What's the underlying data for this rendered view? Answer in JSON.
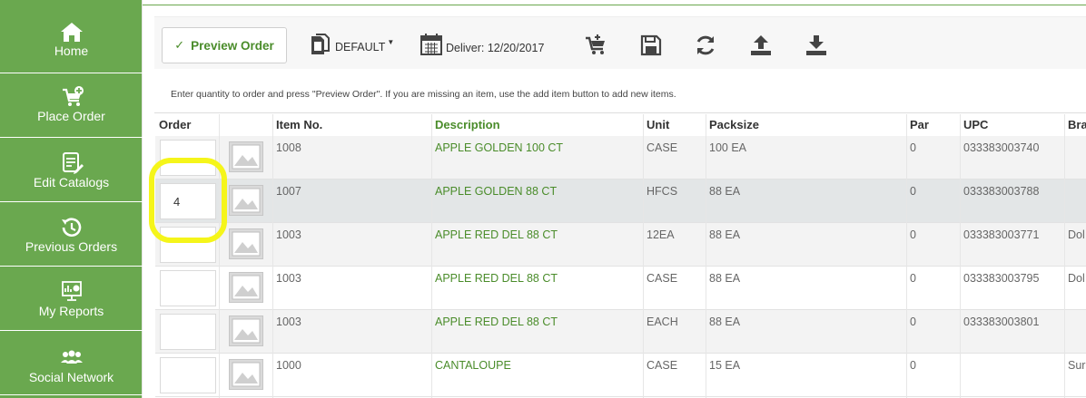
{
  "sidebar": {
    "items": [
      {
        "label": "Home",
        "icon": "home-icon"
      },
      {
        "label": "Place Order",
        "icon": "cart-plus-icon"
      },
      {
        "label": "Edit Catalogs",
        "icon": "edit-catalog-icon"
      },
      {
        "label": "Previous Orders",
        "icon": "history-icon"
      },
      {
        "label": "My Reports",
        "icon": "reports-icon"
      },
      {
        "label": "Social Network",
        "icon": "people-icon"
      }
    ]
  },
  "toolbar": {
    "preview_label": "Preview Order",
    "catalog_label": "DEFAULT",
    "deliver_label": "Deliver: 12/20/2017"
  },
  "hint": "Enter quantity to order and press \"Preview Order\". If you are missing an item, use the add item button to add new items.",
  "table": {
    "headers": {
      "order": "Order",
      "item_no": "Item No.",
      "description": "Description",
      "unit": "Unit",
      "packsize": "Packsize",
      "par": "Par",
      "upc": "UPC",
      "brand": "Bra"
    },
    "rows": [
      {
        "qty": "",
        "item_no": "1008",
        "description": "APPLE GOLDEN 100 CT",
        "unit": "CASE",
        "packsize": "100 EA",
        "par": "0",
        "upc": "033383003740",
        "brand": ""
      },
      {
        "qty": "4",
        "item_no": "1007",
        "description": "APPLE GOLDEN 88 CT",
        "unit": "HFCS",
        "packsize": "88 EA",
        "par": "0",
        "upc": "033383003788",
        "brand": ""
      },
      {
        "qty": "",
        "item_no": "1003",
        "description": "APPLE RED DEL 88 CT",
        "unit": "12EA",
        "packsize": "88 EA",
        "par": "0",
        "upc": "033383003771",
        "brand": "Dol"
      },
      {
        "qty": "",
        "item_no": "1003",
        "description": "APPLE RED DEL 88 CT",
        "unit": "CASE",
        "packsize": "88 EA",
        "par": "0",
        "upc": "033383003795",
        "brand": "Dol"
      },
      {
        "qty": "",
        "item_no": "1003",
        "description": "APPLE RED DEL 88 CT",
        "unit": "EACH",
        "packsize": "88 EA",
        "par": "0",
        "upc": "033383003801",
        "brand": ""
      },
      {
        "qty": "",
        "item_no": "1000",
        "description": "CANTALOUPE",
        "unit": "CASE",
        "packsize": "15 EA",
        "par": "0",
        "upc": "",
        "brand": "Sur"
      }
    ]
  },
  "colors": {
    "sidebar": "#6aa84f",
    "accent_text": "#4a8c2a",
    "highlight": "#f5f51a"
  }
}
